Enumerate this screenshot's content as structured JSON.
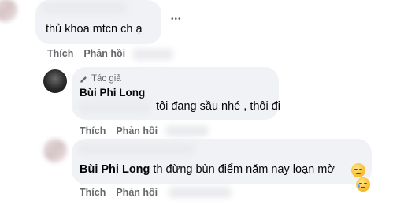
{
  "comment1": {
    "text": "thủ khoa mtcn ch ạ",
    "actions": {
      "like": "Thích",
      "reply": "Phản hồi"
    },
    "more": "•••"
  },
  "reply1": {
    "author_badge": "Tác giả",
    "author": "Bùi Phi Long",
    "text": "tôi đang sầu nhé , thôi đi",
    "actions": {
      "like": "Thích",
      "reply": "Phản hồi"
    }
  },
  "reply2": {
    "mention": "Bùi Phi Long",
    "text": " th đừng bùn điểm năm nay loạn mờ",
    "actions": {
      "like": "Thích",
      "reply": "Phản hồi"
    },
    "emojis": [
      "pensive-face",
      "crying-face"
    ]
  }
}
